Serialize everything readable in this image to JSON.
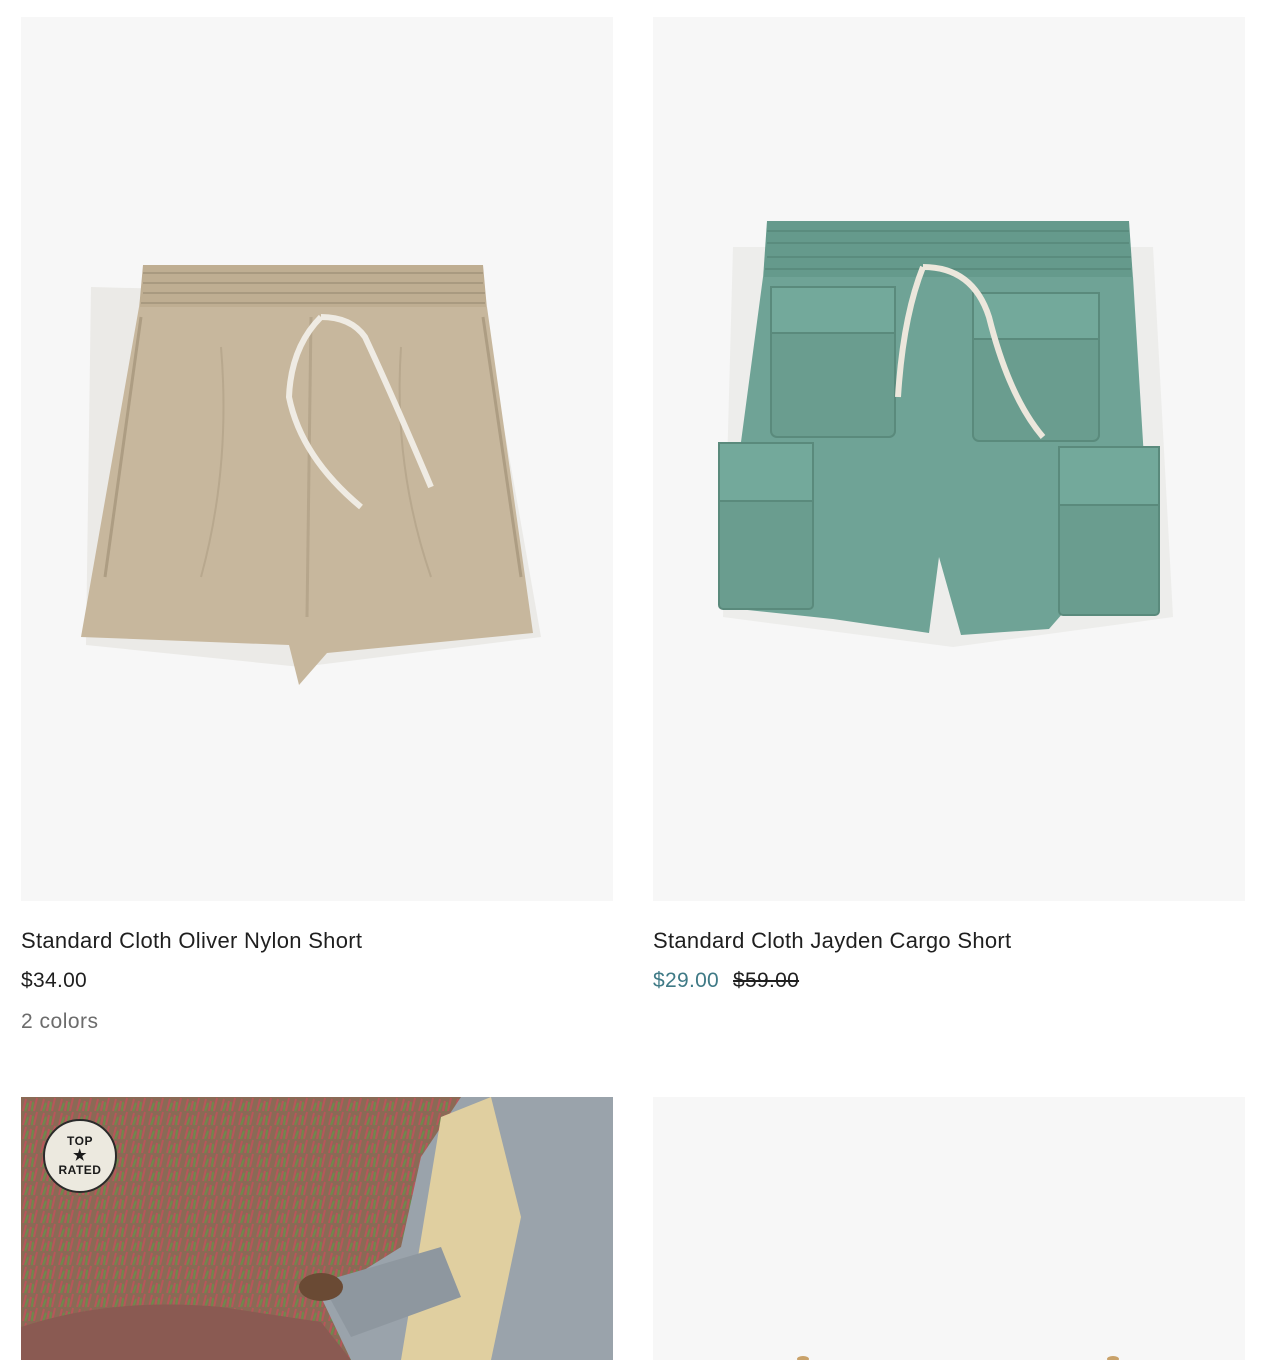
{
  "products": [
    {
      "title": "Standard Cloth Oliver Nylon Short",
      "price": "$34.00",
      "colors": "2 colors",
      "swatch": "#c4b49c"
    },
    {
      "title": "Standard Cloth Jayden Cargo Short",
      "sale_price": "$29.00",
      "original_price": "$59.00",
      "swatch": "#6fa396"
    },
    {
      "badge_top": "TOP",
      "badge_bottom": "RATED"
    },
    {}
  ]
}
